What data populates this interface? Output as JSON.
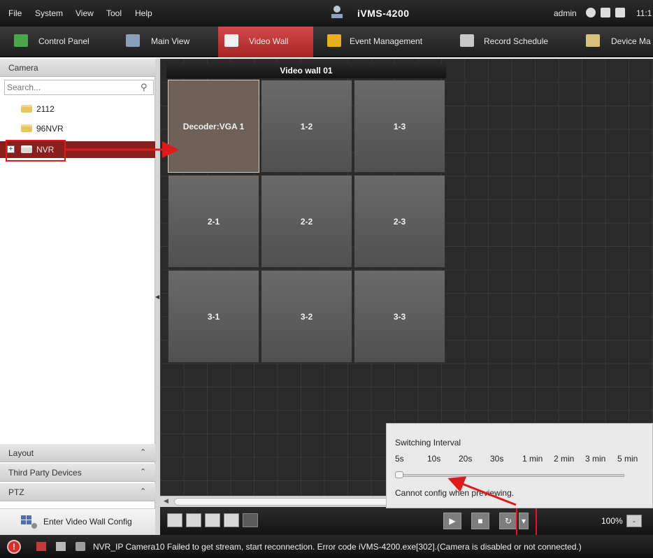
{
  "menu": {
    "file": "File",
    "system": "System",
    "view": "View",
    "tool": "Tool",
    "help": "Help"
  },
  "app": {
    "title": "iVMS-4200",
    "user": "admin",
    "clock": "11:1"
  },
  "tabs": [
    {
      "label": "Control Panel",
      "icon": "control-panel-icon"
    },
    {
      "label": "Main View",
      "icon": "main-view-icon"
    },
    {
      "label": "Video Wall",
      "icon": "video-wall-icon",
      "active": true
    },
    {
      "label": "Event Management",
      "icon": "event-folder-icon"
    },
    {
      "label": "Record Schedule",
      "icon": "record-schedule-icon"
    },
    {
      "label": "Device Ma",
      "icon": "device-management-icon"
    }
  ],
  "left_panel": {
    "camera_header": "Camera",
    "search_placeholder": "Search...",
    "tree": [
      {
        "label": "2112"
      },
      {
        "label": "96NVR"
      },
      {
        "label": "NVR",
        "selected": true
      }
    ],
    "sections": [
      {
        "label": "Layout"
      },
      {
        "label": "Third Party Devices"
      },
      {
        "label": "PTZ"
      }
    ],
    "enter_config": "Enter Video Wall Config"
  },
  "video_wall": {
    "title": "Video wall 01",
    "cells": [
      "Decoder:VGA 1",
      "1-2",
      "1-3",
      "2-1",
      "2-2",
      "2-3",
      "3-1",
      "3-2",
      "3-3"
    ]
  },
  "switch_popup": {
    "title": "Switching Interval",
    "intervals": [
      "5s",
      "10s",
      "20s",
      "30s",
      "1 min",
      "2 min",
      "3 min",
      "5 min"
    ],
    "message": "Cannot config when previewing."
  },
  "toolbar": {
    "zoom": "100%",
    "zoom_out": "-"
  },
  "status": {
    "message": "NVR_IP Camera10 Failed to get stream, start reconnection. Error code iVMS-4200.exe[302].(Camera is disabled or not connected.)"
  },
  "colors": {
    "active_tab": "#c03434",
    "selected_tree": "#8a1f1f",
    "annotation": "#e01a1a"
  }
}
